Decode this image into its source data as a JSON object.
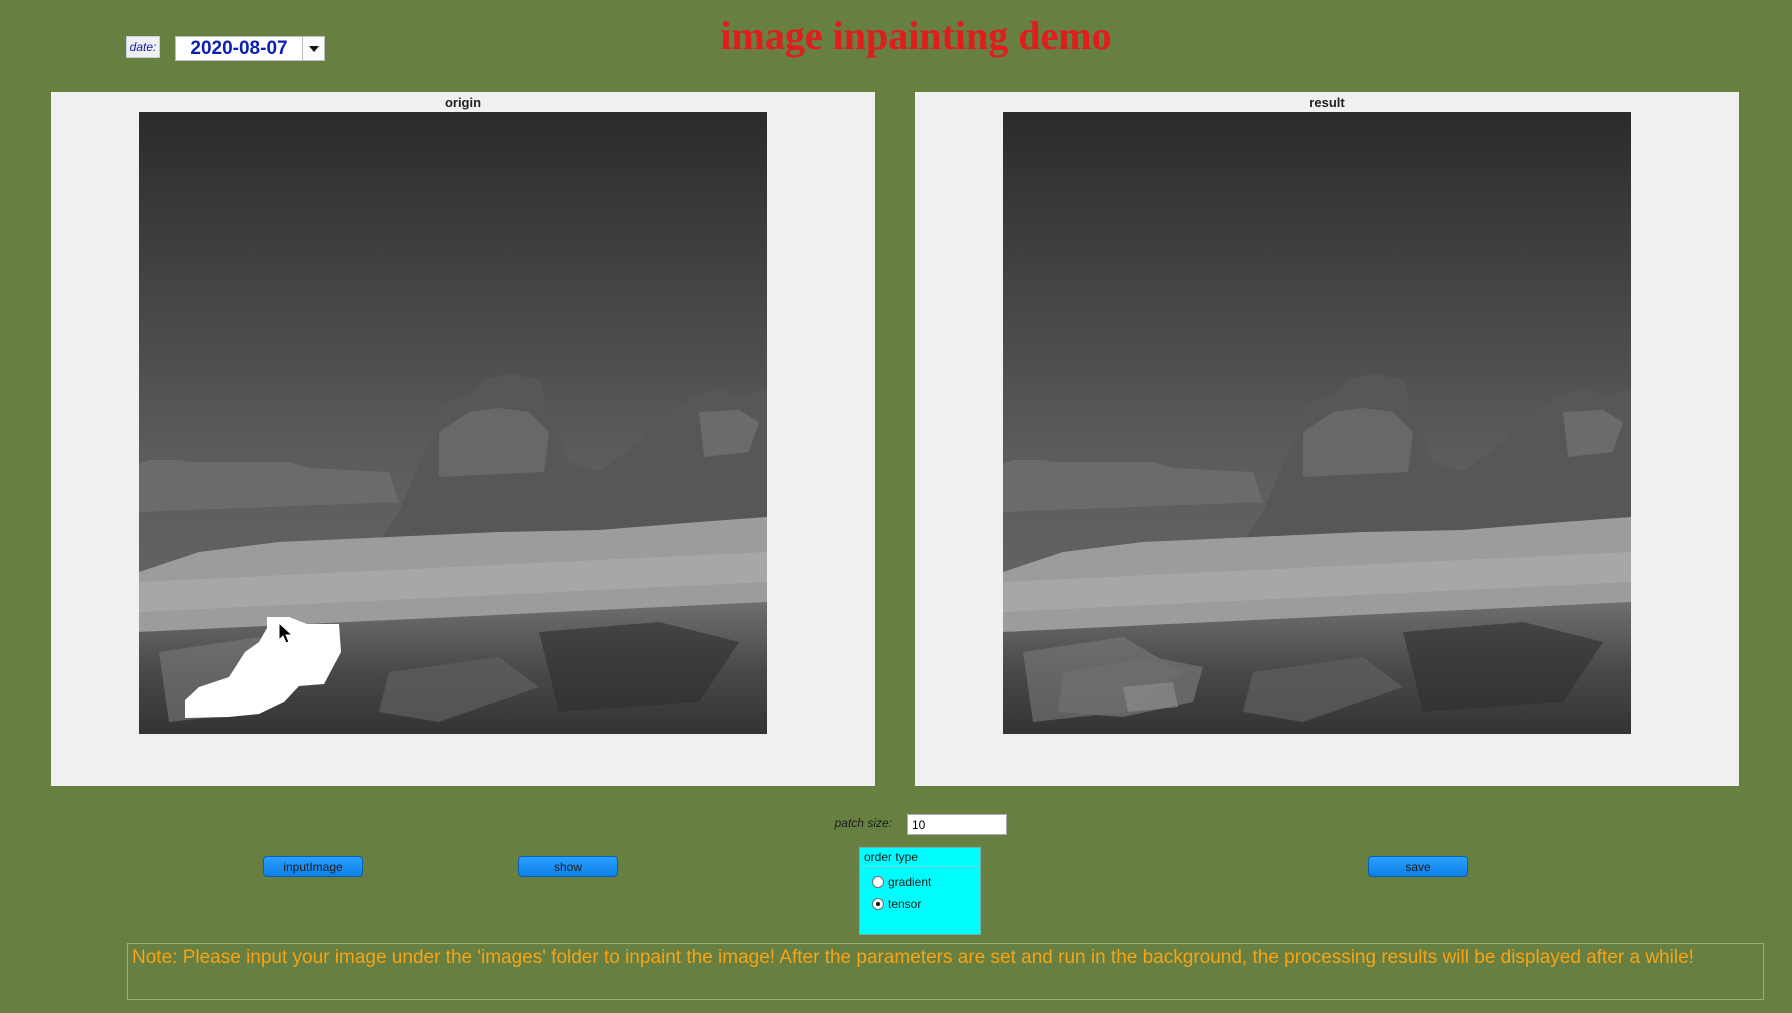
{
  "header": {
    "title": "image inpainting demo",
    "date_label": "date:",
    "date_value": "2020-08-07"
  },
  "panels": {
    "origin": {
      "title": "origin"
    },
    "result": {
      "title": "result"
    }
  },
  "controls": {
    "patch_size_label": "patch size:",
    "patch_size_value": "10",
    "input_image_label": "inputImage",
    "show_label": "show",
    "save_label": "save",
    "order_type": {
      "title": "order type",
      "options": [
        "gradient",
        "tensor"
      ],
      "selected": "tensor"
    }
  },
  "note": "Note: Please input your image under the 'images' folder to inpaint the image! After the parameters are set and run in the background, the processing results will be displayed after a while!",
  "colors": {
    "background": "#677f40",
    "title": "#e21b1b",
    "note_text": "#f5a418",
    "button": "#1b8ff2",
    "order_group": "#00fdfd"
  },
  "icons": {
    "date_dropdown": "chevron-down-icon",
    "cursor": "mouse-pointer-icon"
  }
}
